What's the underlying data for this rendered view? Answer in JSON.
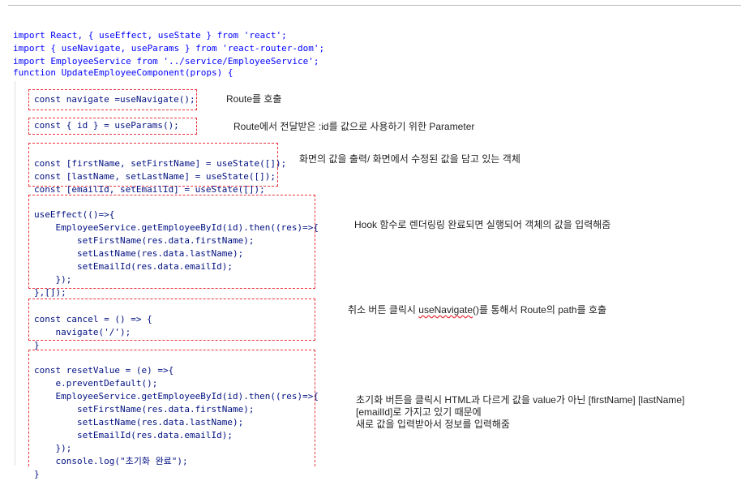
{
  "imports": [
    "import React, { useEffect, useState } from 'react';",
    "import { useNavigate, useParams } from 'react-router-dom';",
    "import EmployeeService from '../service/EmployeeService';"
  ],
  "function_line": "function UpdateEmployeeComponent(props) {",
  "blocks": {
    "navigate": [
      "const navigate =useNavigate();"
    ],
    "params": [
      "const { id } = useParams();"
    ],
    "state": [
      "const [firstName, setFirstName] = useState([]);",
      "const [lastName, setLastName] = useState([]);",
      "const [emailId, setEmailId] = useState([]);"
    ],
    "effect": [
      "useEffect(()=>{",
      "    EmployeeService.getEmployeeById(id).then((res)=>{",
      "        setFirstName(res.data.firstName);",
      "        setLastName(res.data.lastName);",
      "        setEmailId(res.data.emailId);",
      "    });",
      "},[]);"
    ],
    "cancel": [
      "const cancel = () => {",
      "    navigate('/');",
      "}"
    ],
    "reset": [
      "const resetValue = (e) =>{",
      "    e.preventDefault();",
      "    EmployeeService.getEmployeeById(id).then((res)=>{",
      "        setFirstName(res.data.firstName);",
      "        setLastName(res.data.lastName);",
      "        setEmailId(res.data.emailId);",
      "    });",
      "    console.log(\"초기화 완료\");",
      "}"
    ]
  },
  "annotations": {
    "navigate": "Route를 호출",
    "params": "Route에서 전달받은 :id를 값으로 사용하기 위한 Parameter",
    "state": "화면의 값을 출력/ 화면에서 수정된 값을 담고 있는 객체",
    "effect": "Hook 함수로 렌더링링 완료되면 실행되어 객체의 값을 입력해줌",
    "cancel_pre": "취소 버튼 클릭시 ",
    "cancel_link": "useNavigate",
    "cancel_post": "()를 통해서 Route의 path를 호출",
    "reset_line1": "초기화 버튼을 클릭시 HTML과 다르게 값을 value가 아닌 [firstName] [lastName]",
    "reset_line2": "[emailId]로 가지고 있기 때문에",
    "reset_line3": "새로 값을 입력받아서 정보를 입력해줌"
  }
}
